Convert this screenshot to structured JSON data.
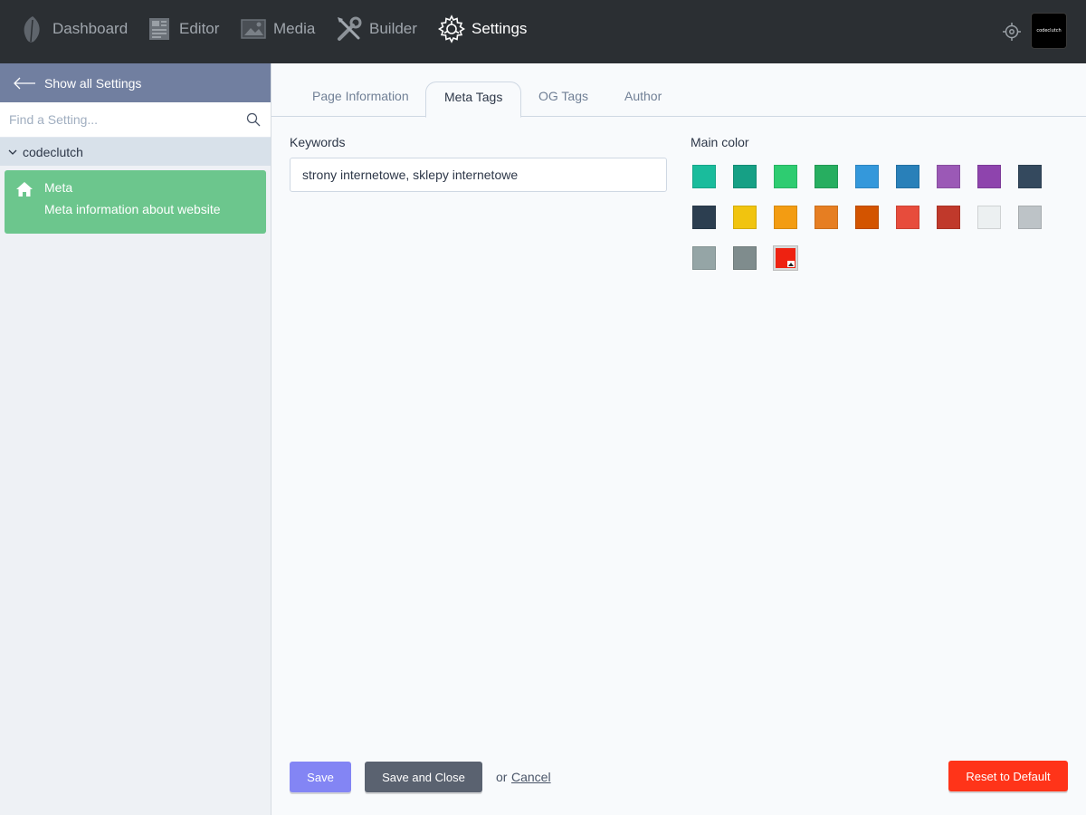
{
  "nav": {
    "items": [
      {
        "label": "Dashboard",
        "icon": "leaf-icon"
      },
      {
        "label": "Editor",
        "icon": "newspaper-icon"
      },
      {
        "label": "Media",
        "icon": "image-icon"
      },
      {
        "label": "Builder",
        "icon": "tools-icon"
      },
      {
        "label": "Settings",
        "icon": "gear-icon",
        "active": true
      }
    ],
    "avatar_text": "codeclutch"
  },
  "sidebar": {
    "show_all_label": "Show all Settings",
    "search_placeholder": "Find a Setting...",
    "group_label": "codeclutch",
    "card": {
      "title": "Meta",
      "description": "Meta information about website"
    }
  },
  "tabs": [
    {
      "label": "Page Information"
    },
    {
      "label": "Meta Tags",
      "active": true
    },
    {
      "label": "OG Tags"
    },
    {
      "label": "Author"
    }
  ],
  "form": {
    "keywords_label": "Keywords",
    "keywords_value": "strony internetowe, sklepy internetowe",
    "main_color_label": "Main color",
    "swatches": [
      "#1abc9c",
      "#16a085",
      "#2ecc71",
      "#27ae60",
      "#3498db",
      "#2980b9",
      "#9b59b6",
      "#8e44ad",
      "#34495e",
      "#2c3e50",
      "#f1c40f",
      "#f39c12",
      "#e67e22",
      "#d35400",
      "#e74c3c",
      "#c0392b",
      "#ecf0f1",
      "#bdc3c7",
      "#95a5a6",
      "#7f8c8d",
      "#ee2211"
    ],
    "selected_swatch": "#ee2211"
  },
  "footer": {
    "save_label": "Save",
    "save_close_label": "Save and Close",
    "or_label": "or",
    "cancel_label": "Cancel",
    "reset_label": "Reset to Default"
  }
}
